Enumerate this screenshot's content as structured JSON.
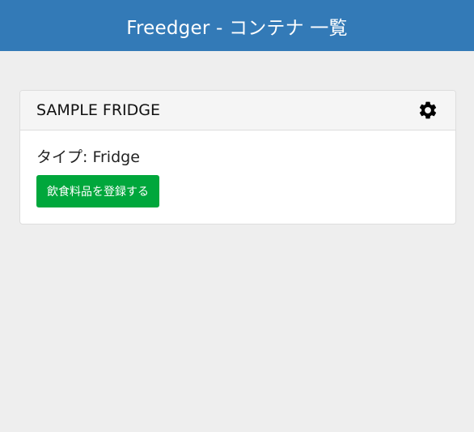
{
  "header": {
    "title": "Freedger - コンテナ 一覧"
  },
  "containers": [
    {
      "name": "SAMPLE FRIDGE",
      "type_label": "タイプ:",
      "type_value": "Fridge",
      "register_button_label": "飲食料品を登録する",
      "settings_icon": "gear-icon"
    }
  ],
  "colors": {
    "header_bg": "#337ab7",
    "page_bg": "#eeeeee",
    "button_bg": "#00a73c"
  }
}
